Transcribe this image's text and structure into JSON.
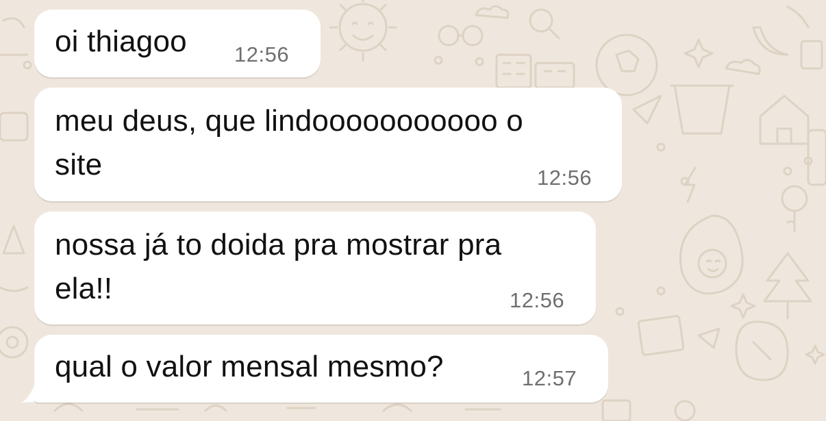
{
  "messages": [
    {
      "lines": [
        "oi thiagoo"
      ],
      "time": "12:56"
    },
    {
      "lines": [
        "meu deus, que lindooooooooooo o",
        "site"
      ],
      "time": "12:56"
    },
    {
      "lines": [
        "nossa já to doida pra mostrar pra",
        "ela!!"
      ],
      "time": "12:56"
    },
    {
      "lines": [
        "qual o valor mensal mesmo?"
      ],
      "time": "12:57"
    }
  ],
  "colors": {
    "wallpaper": "#efe7dd",
    "wallpaper_doodle": "#ddd2c3",
    "bubble": "#ffffff",
    "text": "#111111",
    "time": "#6f6f6f"
  }
}
